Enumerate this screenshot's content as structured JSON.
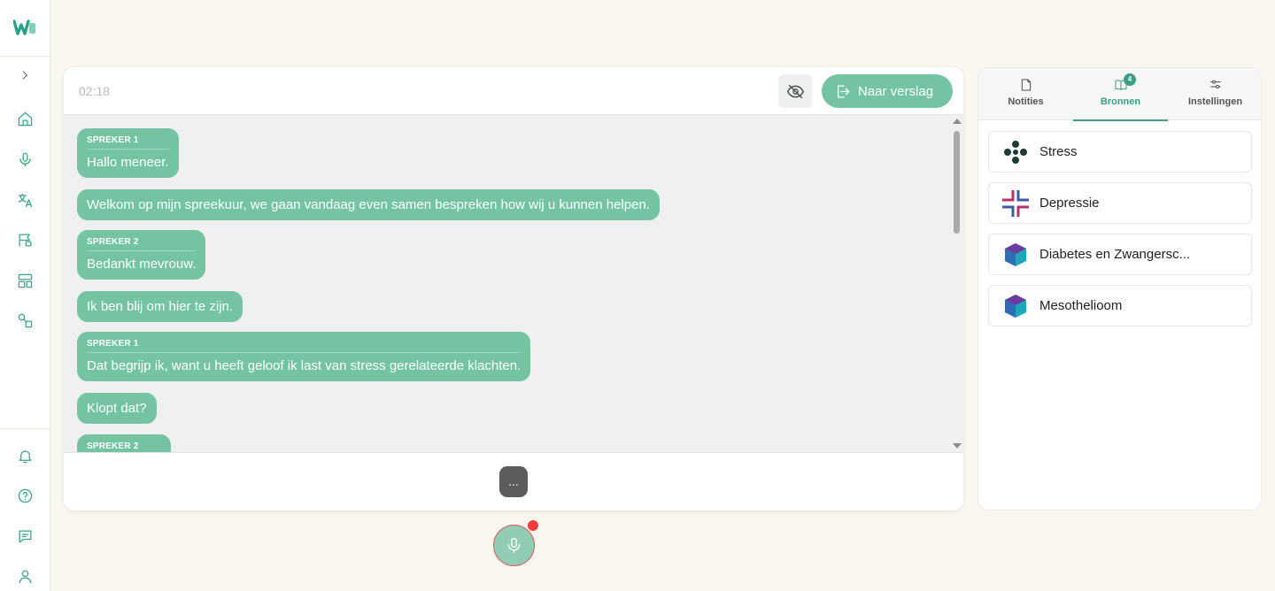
{
  "sidebar": {
    "brand_color": "#3aa38c",
    "top_items": [
      "expand-icon",
      "home-icon",
      "microphone-icon",
      "translate-icon",
      "flag-icon",
      "layout-icon",
      "shapes-icon"
    ],
    "bottom_items": [
      "bell-icon",
      "help-icon",
      "chat-icon",
      "user-icon"
    ]
  },
  "session": {
    "timer": "02:18",
    "report_button": "Naar verslag",
    "typing_indicator": "..."
  },
  "transcript": [
    {
      "speaker": "SPREKER 1",
      "text": "Hallo meneer."
    },
    {
      "speaker": "",
      "text": "Welkom op mijn spreekuur, we gaan vandaag even samen bespreken how wij u kunnen helpen."
    },
    {
      "speaker": "SPREKER 2",
      "text": "Bedankt mevrouw."
    },
    {
      "speaker": "",
      "text": "Ik ben blij om hier te zijn."
    },
    {
      "speaker": "SPREKER 1",
      "text": "Dat begrijp ik, want u heeft geloof ik last van stress gerelateerde klachten."
    },
    {
      "speaker": "",
      "text": "Klopt dat?"
    },
    {
      "speaker": "SPREKER 2",
      "text": ""
    }
  ],
  "right_panel": {
    "tabs": [
      {
        "label": "Notities",
        "icon": "note-icon"
      },
      {
        "label": "Bronnen",
        "icon": "book-icon",
        "badge": "4",
        "active": true
      },
      {
        "label": "Instellingen",
        "icon": "sliders-icon"
      }
    ],
    "sources": [
      {
        "name": "Stress",
        "icon": "stress-logo"
      },
      {
        "name": "Depressie",
        "icon": "depressie-logo"
      },
      {
        "name": "Diabetes en Zwangersc...",
        "icon": "cube-logo"
      },
      {
        "name": "Mesothelioom",
        "icon": "cube-logo"
      }
    ]
  },
  "colors": {
    "accent": "#74c4a4",
    "accent_dark": "#3a9f86",
    "recording": "#ee3b3b"
  }
}
